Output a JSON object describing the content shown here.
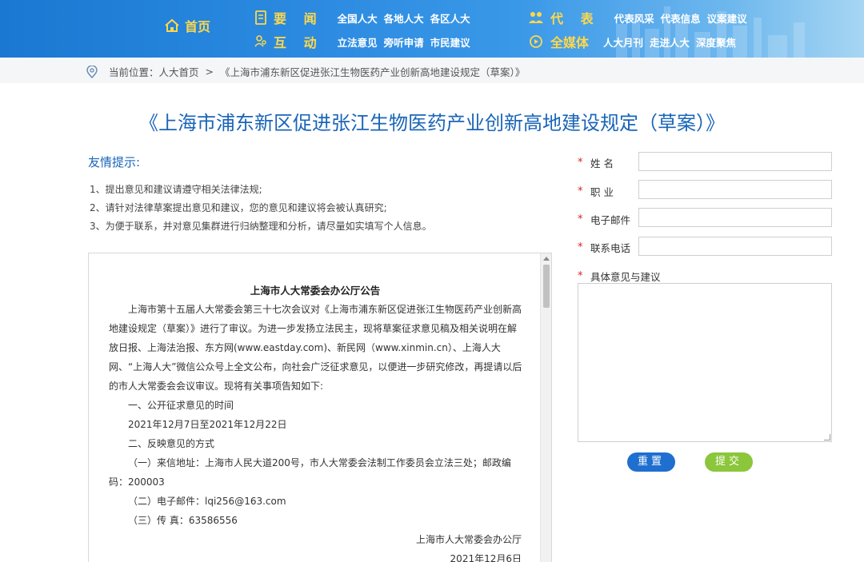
{
  "header": {
    "home_label": "首页",
    "groups": [
      {
        "head": "要 闻",
        "links": [
          "全国人大",
          "各地人大",
          "各区人大"
        ]
      },
      {
        "head": "互 动",
        "links": [
          "立法意见",
          "旁听申请",
          "市民建议"
        ]
      },
      {
        "head": "代 表",
        "links": [
          "代表风采",
          "代表信息",
          "议案建议"
        ]
      },
      {
        "head": "全媒体",
        "links": [
          "人大月刊",
          "走进人大",
          "深度聚焦"
        ]
      }
    ]
  },
  "breadcrumb": {
    "prefix": "当前位置：",
    "home": "人大首页",
    "sep": ">",
    "current": "《上海市浦东新区促进张江生物医药产业创新高地建设规定（草案）》"
  },
  "page_title": "《上海市浦东新区促进张江生物医药产业创新高地建设规定（草案）》",
  "tips": {
    "title": "友情提示:",
    "lines": [
      "1、提出意见和建议请遵守相关法律法规;",
      "2、请针对法律草案提出意见和建议，您的意见和建议将会被认真研究;",
      "3、为便于联系，并对意见集群进行归纳整理和分析，请尽量如实填写个人信息。"
    ]
  },
  "notice": {
    "title": "上海市人大常委会办公厅公告",
    "paragraph1": "上海市第十五届人大常委会第三十七次会议对《上海市浦东新区促进张江生物医药产业创新高地建设规定（草案）》进行了审议。为进一步发扬立法民主，现将草案征求意见稿及相关说明在解放日报、上海法治报、东方网(www.eastday.com)、新民网（www.xinmin.cn）、上海人大网、“上海人大”微信公众号上全文公布，向社会广泛征求意见，以便进一步研究修改，再提请以后的市人大常委会会议审议。现将有关事项告知如下:",
    "section1": "一、公开征求意见的时间",
    "dates": "2021年12月7日至2021年12月22日",
    "section2": "二、反映意见的方式",
    "mail": "（一）来信地址：上海市人民大道200号，市人大常委会法制工作委员会立法三处；邮政编码：200003",
    "email": "（二）电子邮件：lqi256@163.com",
    "fax": "（三）传 真：63586556",
    "signature": "上海市人大常委会办公厅",
    "date": "2021年12月6日"
  },
  "form": {
    "name_label": "姓 名",
    "job_label": "职 业",
    "email_label": "电子邮件",
    "phone_label": "联系电话",
    "opinion_label": "具体意见与建议",
    "required_mark": "*",
    "name_value": "",
    "job_value": "",
    "email_value": "",
    "phone_value": "",
    "reset_label": "重置",
    "submit_label": "提交"
  }
}
